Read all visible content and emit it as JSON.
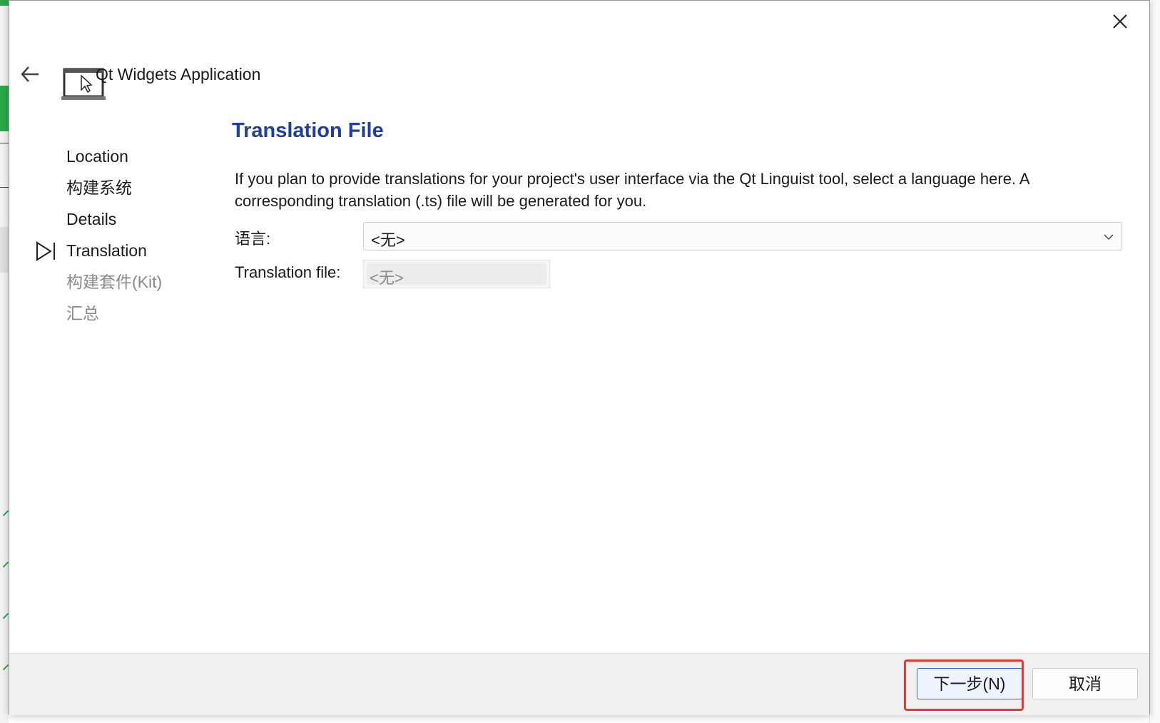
{
  "window": {
    "app_title": "Qt Widgets Application"
  },
  "steps": [
    {
      "label": "Location",
      "state": "done"
    },
    {
      "label": "构建系统",
      "state": "done"
    },
    {
      "label": "Details",
      "state": "done"
    },
    {
      "label": "Translation",
      "state": "current"
    },
    {
      "label": "构建套件(Kit)",
      "state": "future"
    },
    {
      "label": "汇总",
      "state": "future"
    }
  ],
  "page": {
    "heading": "Translation File",
    "description": "If you plan to provide translations for your project's user interface via the Qt Linguist tool, select a language here. A corresponding translation (.ts) file will be generated for you.",
    "language_label": "语言:",
    "language_value": "<无>",
    "translation_file_label": "Translation file:",
    "translation_file_value": "<无>"
  },
  "footer": {
    "next_label": "下一步(N)",
    "cancel_label": "取消"
  },
  "colors": {
    "heading": "#1f3f99",
    "highlight": "#e53935",
    "future_step": "#8a8a8a"
  },
  "icons": [
    "close-icon",
    "back-arrow-icon",
    "app-window-icon",
    "current-step-icon",
    "chevron-down-icon"
  ]
}
